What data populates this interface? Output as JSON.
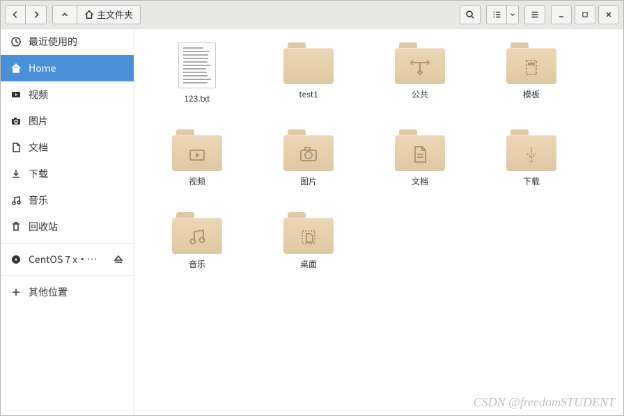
{
  "toolbar": {
    "path_label": "主文件夹"
  },
  "sidebar": {
    "items": [
      {
        "id": "recent",
        "label": "最近使用的",
        "icon": "clock"
      },
      {
        "id": "home",
        "label": "Home",
        "icon": "home",
        "active": true
      },
      {
        "id": "videos",
        "label": "视频",
        "icon": "video"
      },
      {
        "id": "pictures",
        "label": "图片",
        "icon": "camera"
      },
      {
        "id": "documents",
        "label": "文档",
        "icon": "document"
      },
      {
        "id": "downloads",
        "label": "下载",
        "icon": "download"
      },
      {
        "id": "music",
        "label": "音乐",
        "icon": "music"
      },
      {
        "id": "trash",
        "label": "回收站",
        "icon": "trash"
      },
      {
        "id": "centos",
        "label": "CentOS 7 x···",
        "icon": "disc",
        "eject": true
      },
      {
        "id": "other",
        "label": "其他位置",
        "icon": "plus"
      }
    ]
  },
  "files": [
    {
      "name": "123.txt",
      "type": "text"
    },
    {
      "name": "test1",
      "type": "folder",
      "glyph": ""
    },
    {
      "name": "公共",
      "type": "folder",
      "glyph": "public"
    },
    {
      "name": "模板",
      "type": "folder",
      "glyph": "template"
    },
    {
      "name": "视频",
      "type": "folder",
      "glyph": "video"
    },
    {
      "name": "图片",
      "type": "folder",
      "glyph": "camera"
    },
    {
      "name": "文档",
      "type": "folder",
      "glyph": "document"
    },
    {
      "name": "下载",
      "type": "folder",
      "glyph": "download"
    },
    {
      "name": "音乐",
      "type": "folder",
      "glyph": "music"
    },
    {
      "name": "桌面",
      "type": "folder",
      "glyph": "desktop"
    }
  ],
  "watermark": "CSDN @freedomSTUDENT"
}
